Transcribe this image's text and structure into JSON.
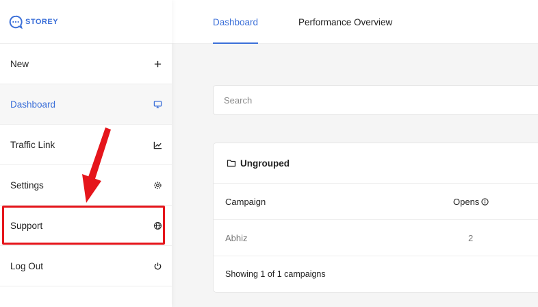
{
  "brand": {
    "name": "STOREY",
    "color": "#3b6fd8"
  },
  "sidebar": {
    "items": [
      {
        "label": "New",
        "icon": "plus-icon"
      },
      {
        "label": "Dashboard",
        "icon": "monitor-icon",
        "active": true
      },
      {
        "label": "Traffic Link",
        "icon": "chart-line-icon"
      },
      {
        "label": "Settings",
        "icon": "gear-icon"
      },
      {
        "label": "Support",
        "icon": "globe-icon",
        "highlighted": true
      },
      {
        "label": "Log Out",
        "icon": "power-icon"
      }
    ]
  },
  "tabs": [
    {
      "label": "Dashboard",
      "active": true
    },
    {
      "label": "Performance Overview",
      "active": false
    }
  ],
  "search": {
    "placeholder": "Search",
    "value": ""
  },
  "campaign_group": {
    "title": "Ungrouped",
    "icon": "folder-icon",
    "columns": [
      "Campaign",
      "Opens"
    ],
    "rows": [
      {
        "campaign": "Abhiz",
        "opens": "2"
      }
    ],
    "footer": "Showing 1 of 1 campaigns"
  },
  "annotation": {
    "highlight_color": "#e5151b"
  }
}
